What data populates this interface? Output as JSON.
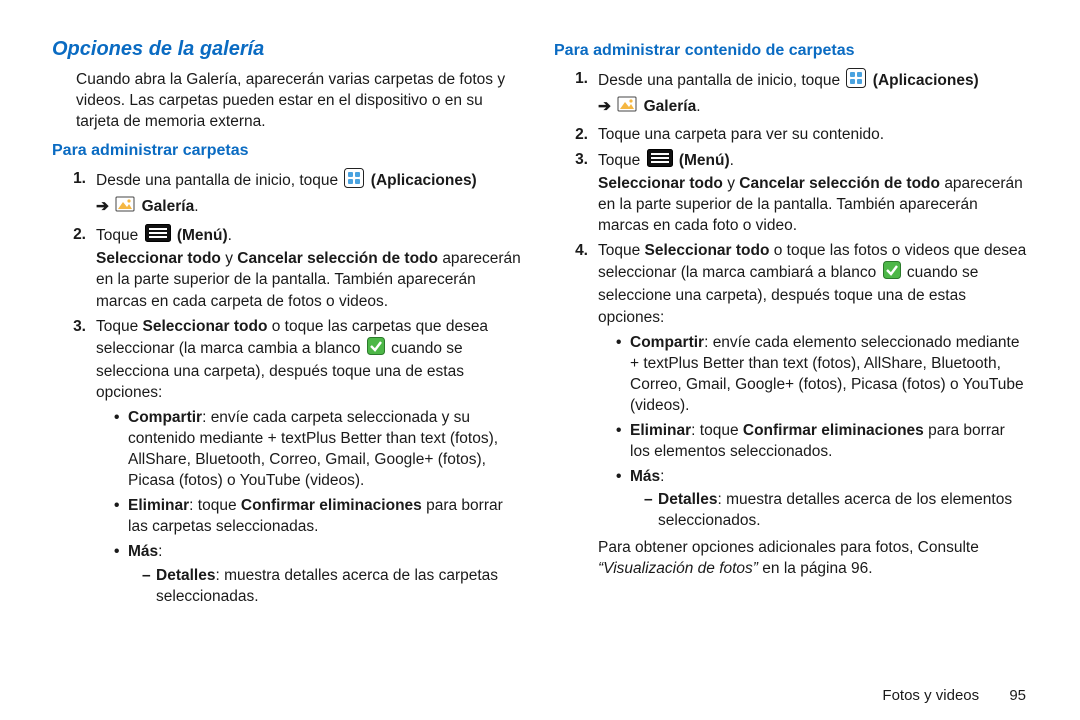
{
  "section_title": "Opciones de la galería",
  "intro": "Cuando abra la Galería, aparecerán varias carpetas de fotos y videos. Las carpetas pueden estar en el dispositivo o en su tarjeta de memoria externa.",
  "left": {
    "heading": "Para administrar carpetas",
    "step1_a": "Desde una pantalla de inicio, toque",
    "apps_label": "(Aplicaciones)",
    "gallery_label": "Galería",
    "step2_a": "Toque",
    "menu_label": "(Menú)",
    "sel_line_a": "Seleccionar todo",
    "sel_line_y": " y ",
    "sel_line_b": "Cancelar selección de todo",
    "sel_after": "aparecerán en la parte superior de la pantalla. También aparecerán marcas en cada carpeta de fotos o videos.",
    "step3_a": "Toque ",
    "step3_b": "Seleccionar todo",
    "step3_c": " o toque las carpetas que desea seleccionar (la marca cambia a blanco ",
    "step3_d": " cuando se selecciona una carpeta), después toque una de estas opciones:",
    "share_lead": "Compartir",
    "share_text": ": envíe cada carpeta seleccionada y su contenido mediante + textPlus Better than text (fotos), AllShare, Bluetooth, Correo, Gmail, Google+ (fotos), Picasa (fotos) o YouTube (videos).",
    "del_lead": "Eliminar",
    "del_text_a": ": toque ",
    "del_text_b": "Confirmar eliminaciones",
    "del_text_c": " para borrar las carpetas seleccionadas.",
    "more_lead": "Más",
    "details_lead": "Detalles",
    "details_text": ": muestra detalles acerca de las carpetas seleccionadas."
  },
  "right": {
    "heading": "Para administrar contenido de carpetas",
    "step1_a": "Desde una pantalla de inicio, toque",
    "apps_label": "(Aplicaciones)",
    "gallery_label": "Galería",
    "step2": "Toque una carpeta para ver su contenido.",
    "step3_a": "Toque",
    "menu_label": "(Menú)",
    "sel_line_a": "Seleccionar todo",
    "sel_line_y": " y ",
    "sel_line_b": "Cancelar selección de todo",
    "sel_after": "aparecerán en la parte superior de la pantalla. También aparecerán marcas en cada foto o video.",
    "step4_a": "Toque ",
    "step4_b": "Seleccionar todo",
    "step4_c": " o toque las fotos o videos que desea seleccionar (la marca cambiará a blanco ",
    "step4_d": " cuando se seleccione una carpeta), después toque una de estas opciones:",
    "share_lead": "Compartir",
    "share_text": ": envíe cada elemento seleccionado mediante + textPlus Better than text (fotos), AllShare, Bluetooth, Correo, Gmail, Google+ (fotos), Picasa (fotos) o YouTube (videos).",
    "del_lead": "Eliminar",
    "del_text_a": ": toque ",
    "del_text_b": "Confirmar eliminaciones",
    "del_text_c": " para borrar los elementos seleccionados.",
    "more_lead": "Más",
    "details_lead": "Detalles",
    "details_text": ": muestra detalles acerca de los elementos seleccionados.",
    "closing_a": "Para obtener opciones adicionales para fotos, Consulte ",
    "closing_ref": "“Visualización de fotos”",
    "closing_b": " en la página 96."
  },
  "footer_label": "Fotos y videos",
  "page_number": "95"
}
